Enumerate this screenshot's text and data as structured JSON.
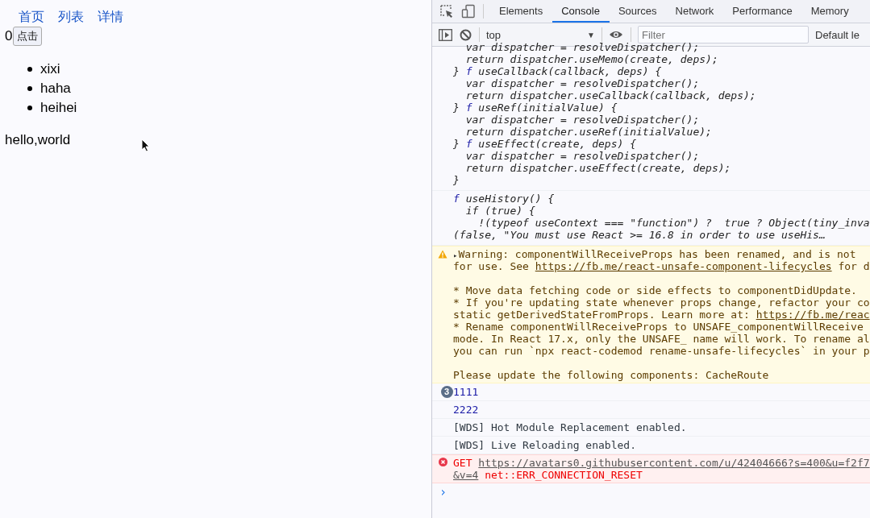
{
  "page": {
    "nav_links": [
      "首页",
      "列表",
      "详情"
    ],
    "counter": "0",
    "button": "点击",
    "list_items": [
      "xixi",
      "haha",
      "heihei"
    ],
    "message": "hello,world"
  },
  "devtools": {
    "tabs": [
      {
        "label": "Elements",
        "selected": false
      },
      {
        "label": "Console",
        "selected": true
      },
      {
        "label": "Sources",
        "selected": false
      },
      {
        "label": "Network",
        "selected": false
      },
      {
        "label": "Performance",
        "selected": false
      },
      {
        "label": "Memory",
        "selected": false
      }
    ],
    "context": "top",
    "dropdown_arrow": "▼",
    "filter": {
      "placeholder": "Filter"
    },
    "levels": "Default le",
    "messages": [
      {
        "kind": "code",
        "paragraphs": [
          [
            "  var dispatcher = resolveDispatcher();",
            "  return dispatcher.useMemo(create, deps);",
            [
              {
                "text": "} ",
                "kind": "text"
              },
              {
                "text": "f",
                "kind": "keyword"
              },
              {
                "text": " useCallback(callback, deps) {",
                "kind": "text"
              }
            ],
            "  var dispatcher = resolveDispatcher();",
            "  return dispatcher.useCallback(callback, deps);",
            [
              {
                "text": "} ",
                "kind": "text"
              },
              {
                "text": "f",
                "kind": "keyword"
              },
              {
                "text": " useRef(initialValue) {",
                "kind": "text"
              }
            ],
            "  var dispatcher = resolveDispatcher();",
            "  return dispatcher.useRef(initialValue);",
            [
              {
                "text": "} ",
                "kind": "text"
              },
              {
                "text": "f",
                "kind": "keyword"
              },
              {
                "text": " useEffect(create, deps) {",
                "kind": "text"
              }
            ],
            "  var dispatcher = resolveDispatcher();",
            "  return dispatcher.useEffect(create, deps);",
            "}"
          ]
        ]
      },
      {
        "kind": "code",
        "paragraphs": [
          [
            [
              {
                "text": "f",
                "kind": "keyword"
              },
              {
                "text": " useHistory() {",
                "kind": "text"
              }
            ],
            "  if (true) {",
            "    !(typeof useContext === \"function\") ?  true ? Object(tiny_inva",
            "(false, \"You must use React >= 16.8 in order to use useHis…"
          ]
        ]
      },
      {
        "kind": "warning",
        "expander": "▸",
        "paragraphs": [
          [
            "Warning: componentWillReceiveProps has been renamed, and is not",
            [
              {
                "text": "for use. See ",
                "kind": "text"
              },
              {
                "text": "https://fb.me/react-unsafe-component-lifecycles",
                "kind": "link"
              },
              {
                "text": " for d",
                "kind": "text"
              }
            ]
          ],
          [
            "* Move data fetching code or side effects to componentDidUpdate.",
            "* If you're updating state whenever props change, refactor your co",
            [
              {
                "text": "static getDerivedStateFromProps. Learn more at: ",
                "kind": "text"
              },
              {
                "text": "https://fb.me/reac",
                "kind": "link"
              }
            ],
            "* Rename componentWillReceiveProps to UNSAFE_componentWillReceive",
            "mode. In React 17.x, only the UNSAFE_ name will work. To rename al",
            "you can run `npx react-codemod rename-unsafe-lifecycles` in your p"
          ],
          [
            "Please update the following components: CacheRoute"
          ]
        ]
      },
      {
        "kind": "number",
        "count": "3",
        "paragraphs": [
          [
            "1111"
          ]
        ]
      },
      {
        "kind": "number",
        "paragraphs": [
          [
            "2222"
          ]
        ]
      },
      {
        "kind": "log",
        "paragraphs": [
          [
            "[WDS] Hot Module Replacement enabled."
          ]
        ]
      },
      {
        "kind": "log",
        "paragraphs": [
          [
            "[WDS] Live Reloading enabled."
          ]
        ]
      },
      {
        "kind": "error",
        "paragraphs": [
          [
            [
              {
                "text": "GET ",
                "kind": "text"
              },
              {
                "text": "https://avatars0.githubusercontent.com/u/42404666?s=400&u=f2f7",
                "kind": "link"
              }
            ],
            [
              {
                "text": "&v=4",
                "kind": "link"
              },
              {
                "text": " net::ERR_CONNECTION_RESET",
                "kind": "text"
              }
            ]
          ]
        ]
      }
    ],
    "prompt": "›"
  }
}
